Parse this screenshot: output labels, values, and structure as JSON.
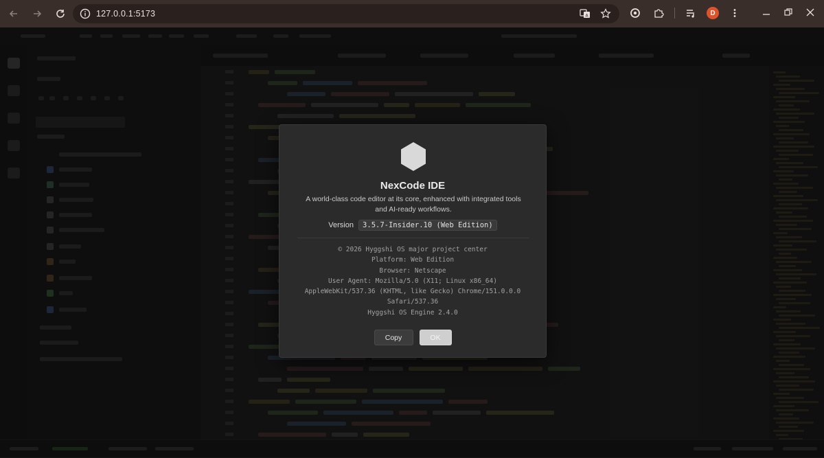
{
  "browser": {
    "url": "127.0.0.1:5173",
    "profile_initial": "D",
    "colors": {
      "frame": "#3a2e2a",
      "omnibox": "#2a201d",
      "profile": "#e0522a"
    },
    "icons": [
      "back-icon",
      "forward-icon",
      "reload-icon",
      "site-info-icon",
      "translate-icon",
      "bookmark-star-icon",
      "extension-puzzle-icon",
      "media-controls-icon",
      "menu-dots-icon",
      "minimize-icon",
      "restore-icon",
      "close-icon"
    ]
  },
  "dialog": {
    "app_name": "NexCode IDE",
    "tagline_line1": "A world-class code editor at its core, enhanced with integrated tools",
    "tagline_line2": "and AI-ready workflows.",
    "version_label": "Version",
    "version_value": "3.5.7-Insider.10 (Web Edition)",
    "info": {
      "copyright": "© 2026 Hyggshi OS major project center",
      "platform": "Platform: Web Edition",
      "browser": "Browser: Netscape",
      "user_agent_1": "User Agent: Mozilla/5.0 (X11; Linux x86_64)",
      "user_agent_2": "AppleWebKit/537.36 (KHTML, like Gecko) Chrome/151.0.0.0",
      "user_agent_3": "Safari/537.36",
      "engine": "Hyggshi OS Engine 2.4.0"
    },
    "buttons": {
      "copy": "Copy",
      "ok": "OK"
    }
  }
}
